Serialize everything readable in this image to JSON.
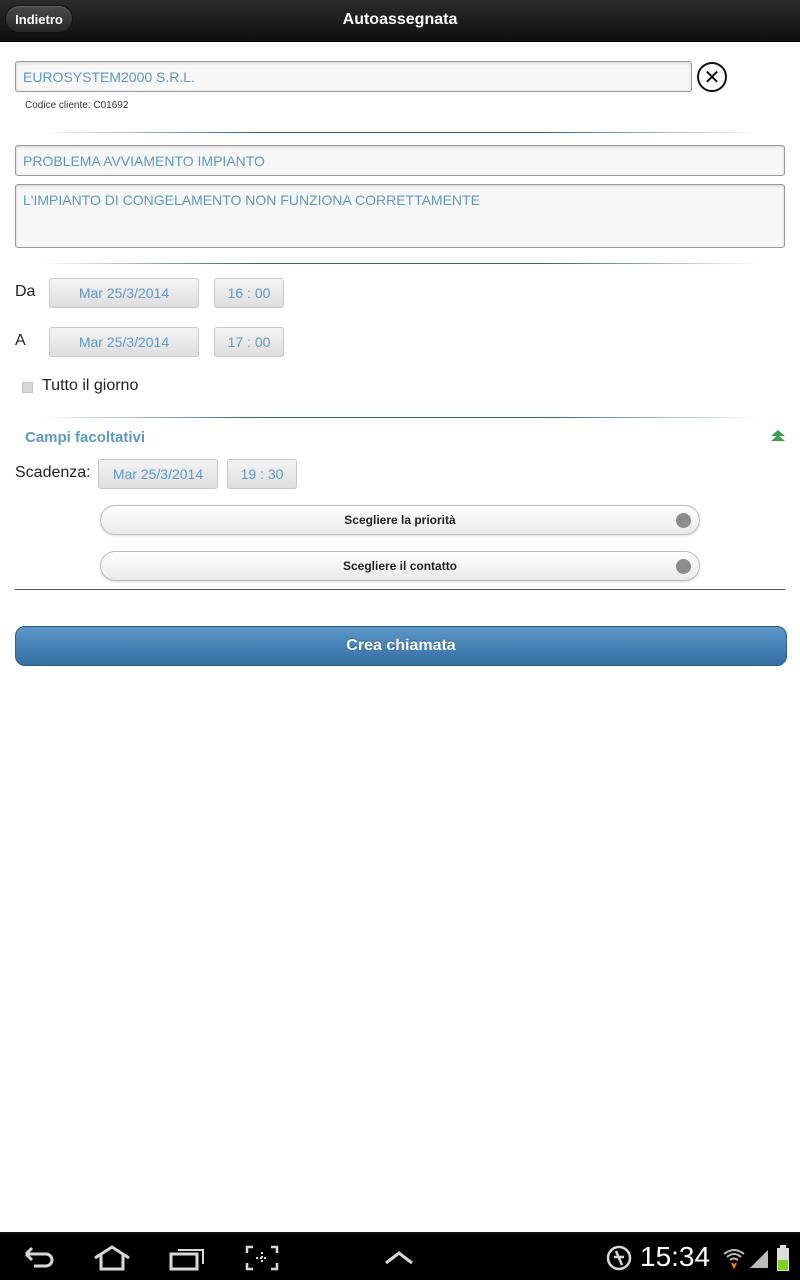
{
  "header": {
    "back_label": "Indietro",
    "title": "Autoassegnata"
  },
  "customer": {
    "name": "EUROSYSTEM2000 S.R.L.",
    "code_label": "Codice cliente: C01692"
  },
  "ticket": {
    "subject": "PROBLEMA AVVIAMENTO IMPIANTO",
    "description": "L'IMPIANTO DI CONGELAMENTO NON FUNZIONA CORRETTAMENTE"
  },
  "schedule": {
    "from_label": "Da",
    "from_date": "Mar 25/3/2014",
    "from_time": "16 : 00",
    "to_label": "A",
    "to_date": "Mar 25/3/2014",
    "to_time": "17 : 00",
    "all_day_label": "Tutto il giorno"
  },
  "optional": {
    "title": "Campi facoltativi",
    "deadline_label": "Scadenza:",
    "deadline_date": "Mar 25/3/2014",
    "deadline_time": "19 : 30",
    "priority_label": "Scegliere la priorità",
    "contact_label": "Scegliere il contatto"
  },
  "actions": {
    "create_label": "Crea chiamata"
  },
  "statusbar": {
    "time": "15:34"
  }
}
